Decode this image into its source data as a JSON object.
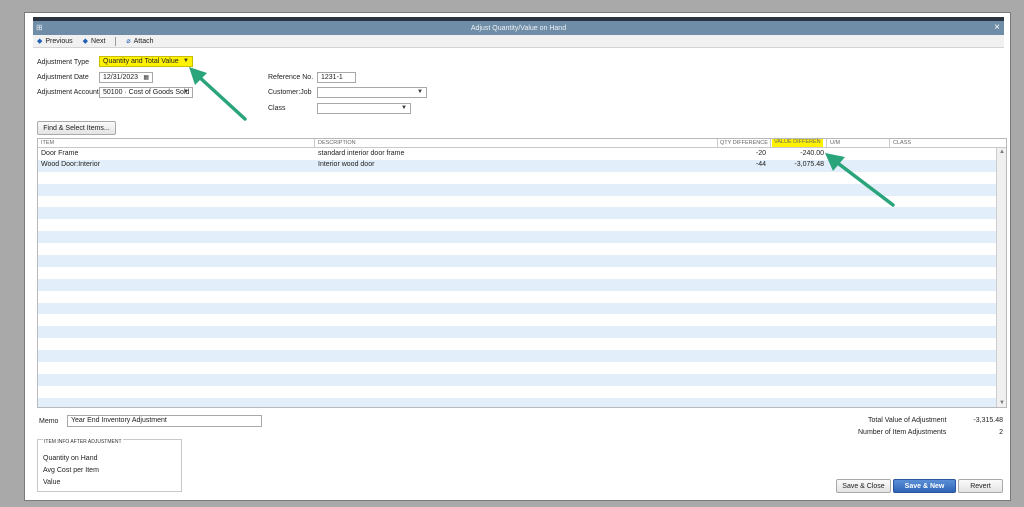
{
  "window": {
    "title": "Adjust Quantity/Value on Hand",
    "close_glyph": "×"
  },
  "toolbar": {
    "previous": "Previous",
    "next": "Next",
    "attach": "Attach"
  },
  "form": {
    "adjustment_type_label": "Adjustment Type",
    "adjustment_type_value": "Quantity and Total Value",
    "adjustment_date_label": "Adjustment Date",
    "adjustment_date_value": "12/31/2023",
    "adjustment_account_label": "Adjustment Account",
    "adjustment_account_value": "50100 · Cost of Goods Sold",
    "reference_no_label": "Reference No.",
    "reference_no_value": "1231-1",
    "customer_job_label": "Customer:Job",
    "customer_job_value": "",
    "class_label": "Class",
    "class_value": ""
  },
  "find_button": "Find & Select Items...",
  "grid": {
    "columns": [
      "ITEM",
      "DESCRIPTION",
      "QTY DIFFERENCE",
      "VALUE DIFFEREN",
      "U/M",
      "CLASS"
    ],
    "rows": [
      {
        "item": "Door Frame",
        "description": "standard interior door frame",
        "qty_difference": "-20",
        "value_difference": "-240.00",
        "um": "",
        "class": ""
      },
      {
        "item": "Wood Door:Interior",
        "description": "Interior wood door",
        "qty_difference": "-44",
        "value_difference": "-3,075.48",
        "um": "",
        "class": ""
      }
    ]
  },
  "memo": {
    "label": "Memo",
    "value": "Year End Inventory Adjustment"
  },
  "item_info": {
    "title": "ITEM INFO AFTER ADJUSTMENT",
    "lines": [
      "Quantity on Hand",
      "Avg Cost per Item",
      "Value"
    ]
  },
  "totals": {
    "total_value_label": "Total Value of Adjustment",
    "total_value": "-3,315.48",
    "num_items_label": "Number of Item Adjustments",
    "num_items": "2"
  },
  "buttons": {
    "save_close": "Save & Close",
    "save_new": "Save & New",
    "revert": "Revert"
  },
  "colors": {
    "highlight": "#fff200",
    "arrow": "#2aa47a",
    "title_bar": "#6f8da6",
    "row_alt": "#e2eef9"
  },
  "icons": {
    "previous": "triangle-left-icon",
    "next": "triangle-right-icon",
    "attach": "paperclip-icon",
    "calendar": "calendar-icon"
  }
}
